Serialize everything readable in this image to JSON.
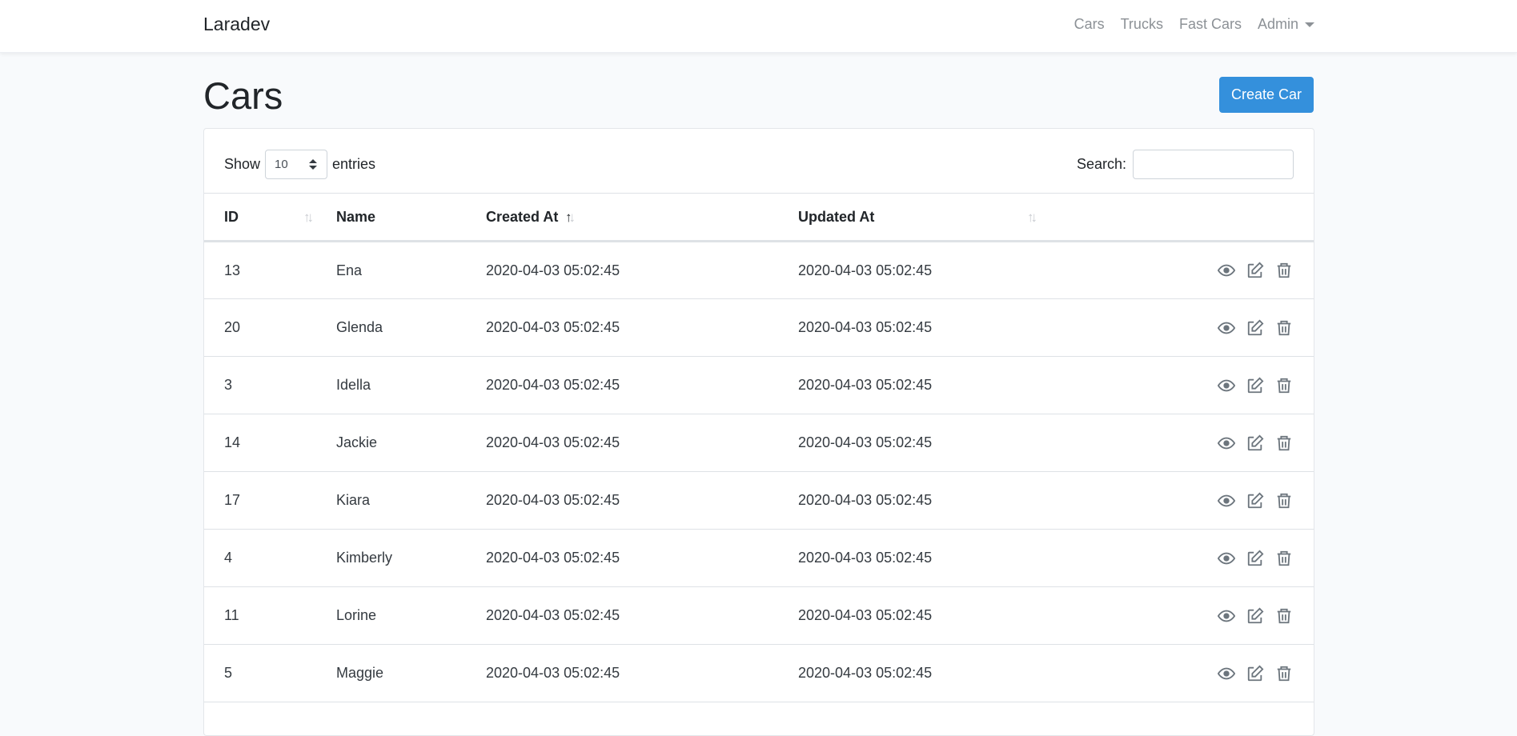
{
  "navbar": {
    "brand": "Laradev",
    "links": [
      "Cars",
      "Trucks",
      "Fast Cars"
    ],
    "admin_label": "Admin"
  },
  "page": {
    "title": "Cars",
    "create_button": "Create Car"
  },
  "table_controls": {
    "show_label": "Show",
    "entries_value": "10",
    "entries_label": "entries",
    "search_label": "Search:",
    "search_value": ""
  },
  "table": {
    "columns": [
      "ID",
      "Name",
      "Created At",
      "Updated At"
    ],
    "sorted_column": "Name",
    "sort_direction": "ascending",
    "rows": [
      {
        "id": "13",
        "name": "Ena",
        "created": "2020-04-03 05:02:45",
        "updated": "2020-04-03 05:02:45"
      },
      {
        "id": "20",
        "name": "Glenda",
        "created": "2020-04-03 05:02:45",
        "updated": "2020-04-03 05:02:45"
      },
      {
        "id": "3",
        "name": "Idella",
        "created": "2020-04-03 05:02:45",
        "updated": "2020-04-03 05:02:45"
      },
      {
        "id": "14",
        "name": "Jackie",
        "created": "2020-04-03 05:02:45",
        "updated": "2020-04-03 05:02:45"
      },
      {
        "id": "17",
        "name": "Kiara",
        "created": "2020-04-03 05:02:45",
        "updated": "2020-04-03 05:02:45"
      },
      {
        "id": "4",
        "name": "Kimberly",
        "created": "2020-04-03 05:02:45",
        "updated": "2020-04-03 05:02:45"
      },
      {
        "id": "11",
        "name": "Lorine",
        "created": "2020-04-03 05:02:45",
        "updated": "2020-04-03 05:02:45"
      },
      {
        "id": "5",
        "name": "Maggie",
        "created": "2020-04-03 05:02:45",
        "updated": "2020-04-03 05:02:45"
      }
    ],
    "row_actions": [
      "eye-icon",
      "edit-icon",
      "trash-icon"
    ]
  },
  "colors": {
    "primary": "#3490dc",
    "background": "#f8fafc",
    "nav_link": "#8c9196",
    "icon": "#6c757d"
  }
}
